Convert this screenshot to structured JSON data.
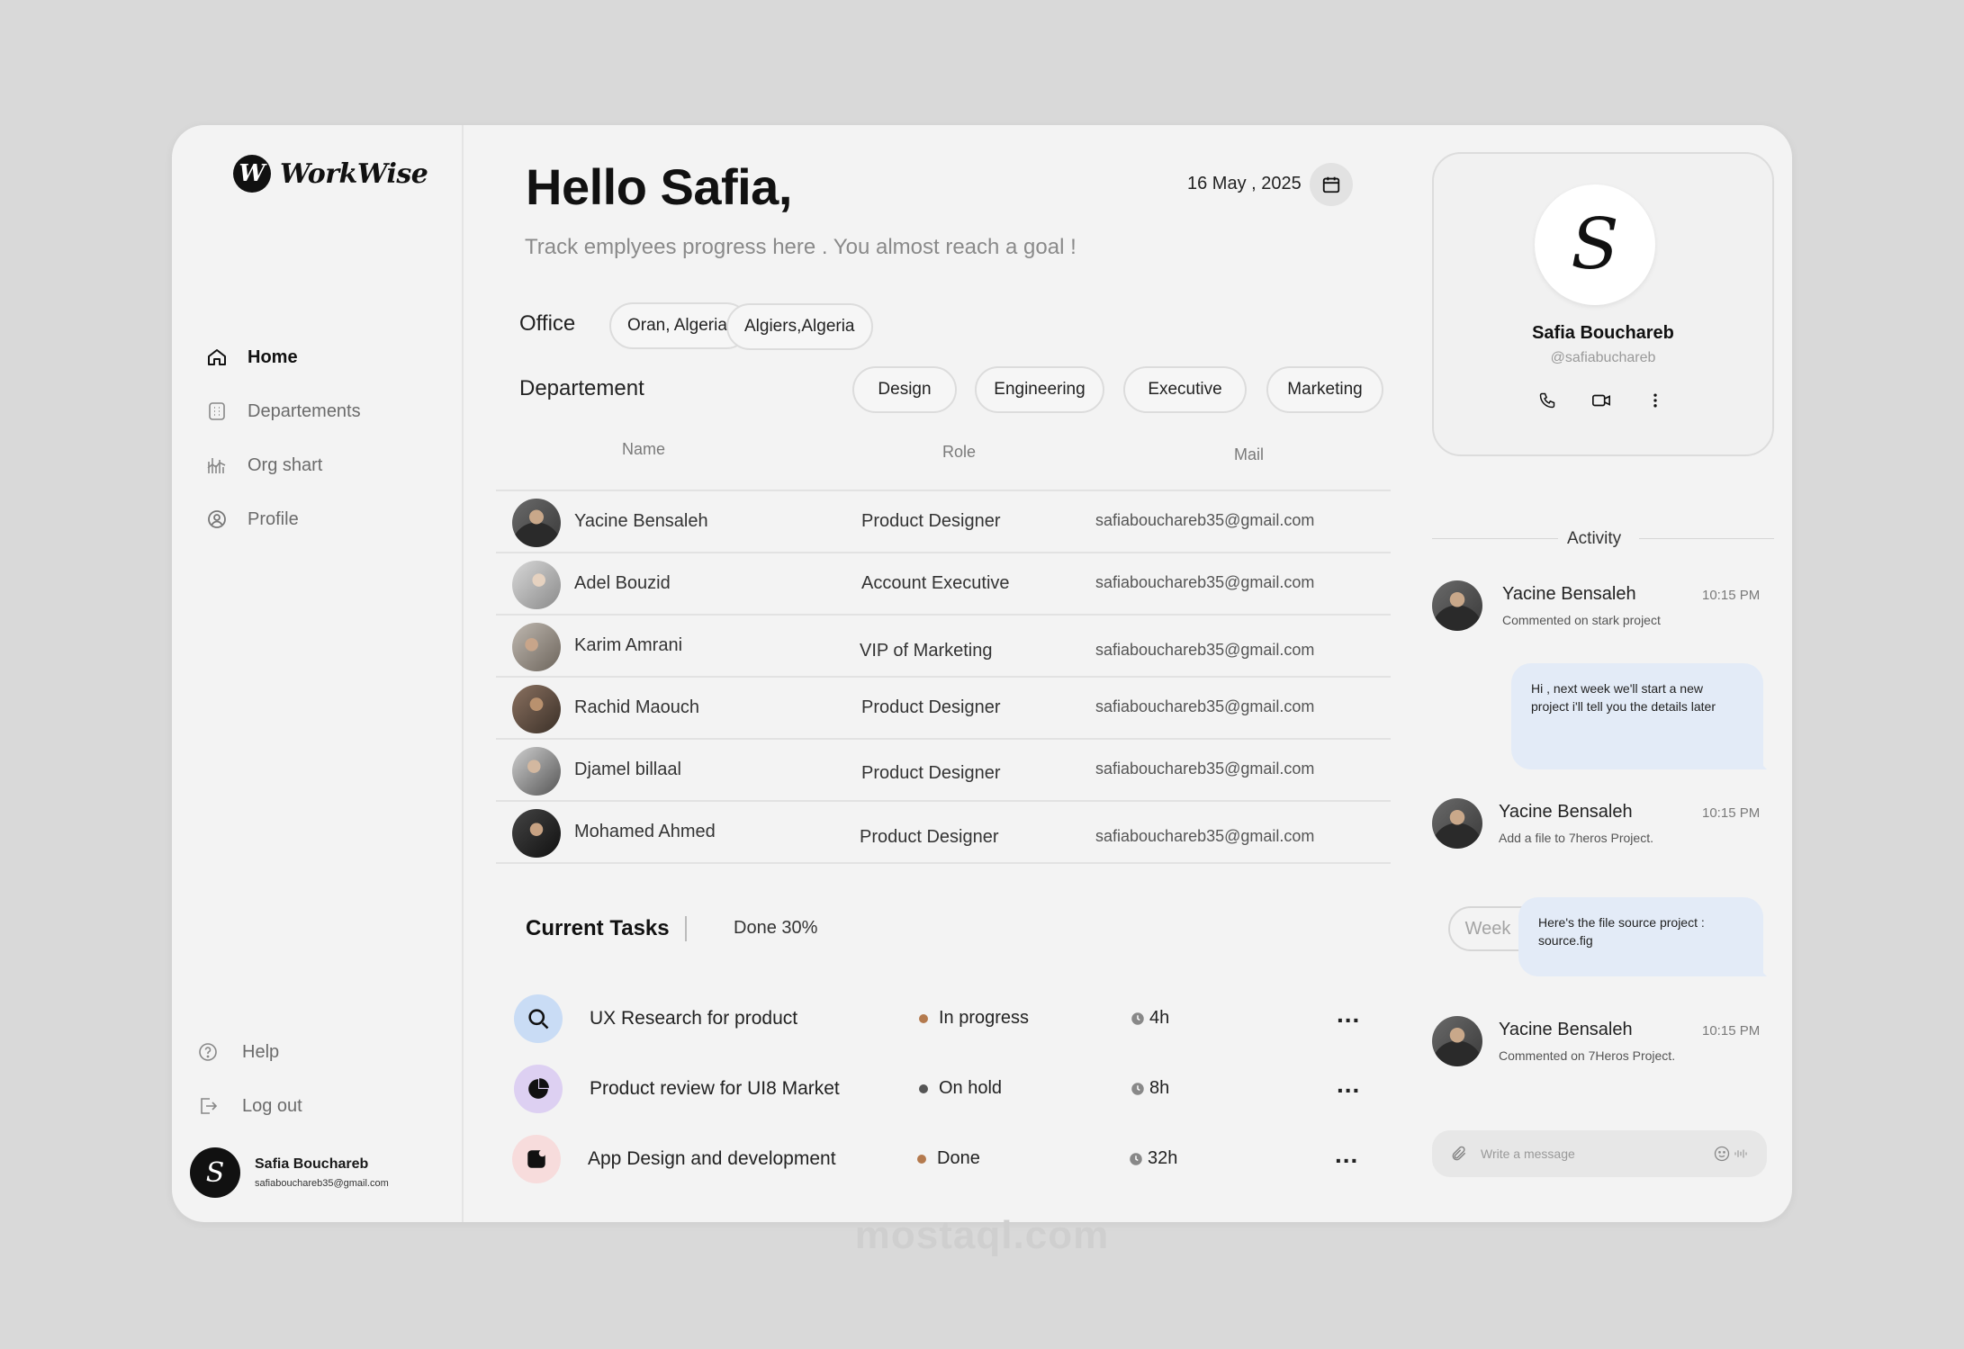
{
  "brand": {
    "logo_letter": "W",
    "name": "WorkWise"
  },
  "sidebar": {
    "items": [
      {
        "label": "Home"
      },
      {
        "label": "Departements"
      },
      {
        "label": "Org shart"
      },
      {
        "label": "Profile"
      }
    ],
    "bottom": [
      {
        "label": "Help"
      },
      {
        "label": "Log out"
      }
    ],
    "user": {
      "name": "Safia Bouchareb",
      "email": "safiabouchareb35@gmail.com"
    }
  },
  "header": {
    "greeting": "Hello Safia,",
    "subtitle": "Track emplyees progress here . You  almost reach a goal !",
    "date": "16 May , 2025"
  },
  "filters": {
    "office_label": "Office",
    "offices": [
      "Oran, Algeria.",
      "Algiers,Algeria"
    ],
    "department_label": "Departement",
    "departments": [
      "Design",
      "Engineering",
      "Executive",
      "Marketing"
    ]
  },
  "employees": {
    "columns": [
      "Name",
      "Role",
      "Mail"
    ],
    "rows": [
      {
        "name": "Yacine Bensaleh",
        "role": "Product Designer",
        "mail": "safiabouchareb35@gmail.com"
      },
      {
        "name": "Adel Bouzid",
        "role": "Account Executive",
        "mail": "safiabouchareb35@gmail.com"
      },
      {
        "name": "Karim Amrani",
        "role": "VIP of Marketing",
        "mail": "safiabouchareb35@gmail.com"
      },
      {
        "name": "Rachid Maouch",
        "role": "Product Designer",
        "mail": "safiabouchareb35@gmail.com"
      },
      {
        "name": "Djamel billaal",
        "role": "Product Designer",
        "mail": "safiabouchareb35@gmail.com"
      },
      {
        "name": "Mohamed Ahmed",
        "role": "Product Designer",
        "mail": "safiabouchareb35@gmail.com"
      }
    ]
  },
  "tasks": {
    "title": "Current Tasks",
    "done": "Done 30%",
    "period": "Week",
    "items": [
      {
        "name": "UX Research for product",
        "status": "In progress",
        "status_color": "#b47a4e",
        "time": "4h",
        "icon": "search-icon",
        "icon_bg": "#c9dcf5"
      },
      {
        "name": "Product review for UI8 Market",
        "status": "On hold",
        "status_color": "#555555",
        "time": "8h",
        "icon": "pie-icon",
        "icon_bg": "#ddd0f2"
      },
      {
        "name": "App Design and development",
        "status": "Done",
        "status_color": "#b47a4e",
        "time": "32h",
        "icon": "app-icon",
        "icon_bg": "#f7dcdc"
      }
    ],
    "more": "..."
  },
  "profile": {
    "initial": "S",
    "name": "Safia Bouchareb",
    "handle": "@safiabuchareb"
  },
  "activity": {
    "title": "Activity",
    "entries": [
      {
        "name": "Yacine Bensaleh",
        "time": "10:15 PM",
        "desc": "Commented on stark project"
      },
      {
        "name": "Yacine Bensaleh",
        "time": "10:15 PM",
        "desc": "Add a file to 7heros Project."
      },
      {
        "name": "Yacine Bensaleh",
        "time": "10:15 PM",
        "desc": "Commented on 7Heros Project."
      }
    ],
    "messages": [
      "Hi , next week we'll start a new project i'll tell you the details later",
      "Here's the file source project : source.fig"
    ],
    "input_placeholder": "Write a message"
  },
  "watermark": "mostaql.com",
  "colors": {
    "page_bg": "#d9d9d9",
    "card_bg": "#f3f3f3",
    "bubble_bg": "#e3ebf7",
    "accent_brown": "#b47a4e"
  }
}
